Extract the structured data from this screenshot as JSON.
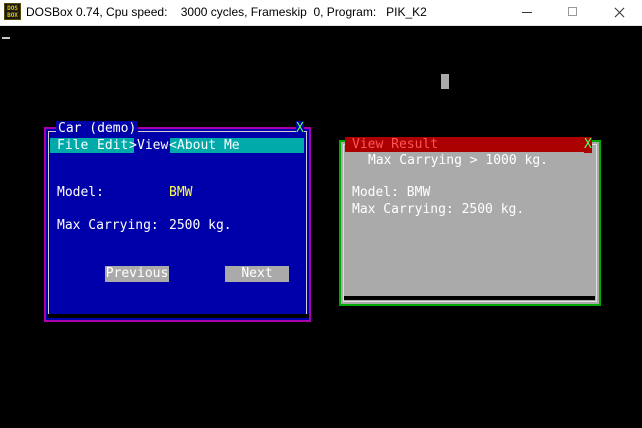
{
  "window": {
    "icon_label": "DOS BOX",
    "title": "DOSBox 0.74, Cpu speed:    3000 cycles, Frameskip  0, Program:   PIK_K2"
  },
  "car_window": {
    "title": "Car (demo)",
    "close_glyph": "X",
    "menu": [
      "File",
      "Edit",
      "View",
      "About Me"
    ],
    "menu_arrows": [
      ">",
      "<"
    ],
    "model_label": "Model:",
    "model_value": "BMW",
    "carrying_label": "Max Carrying:",
    "carrying_value": "2500 kg.",
    "previous_label": "Previous",
    "next_label": "Next"
  },
  "result_window": {
    "title": "View Result",
    "close_glyph": "X",
    "header": "Max Carrying > 1000 kg.",
    "line1": "Model: BMW",
    "line2": "Max Carrying: 2500 kg."
  }
}
